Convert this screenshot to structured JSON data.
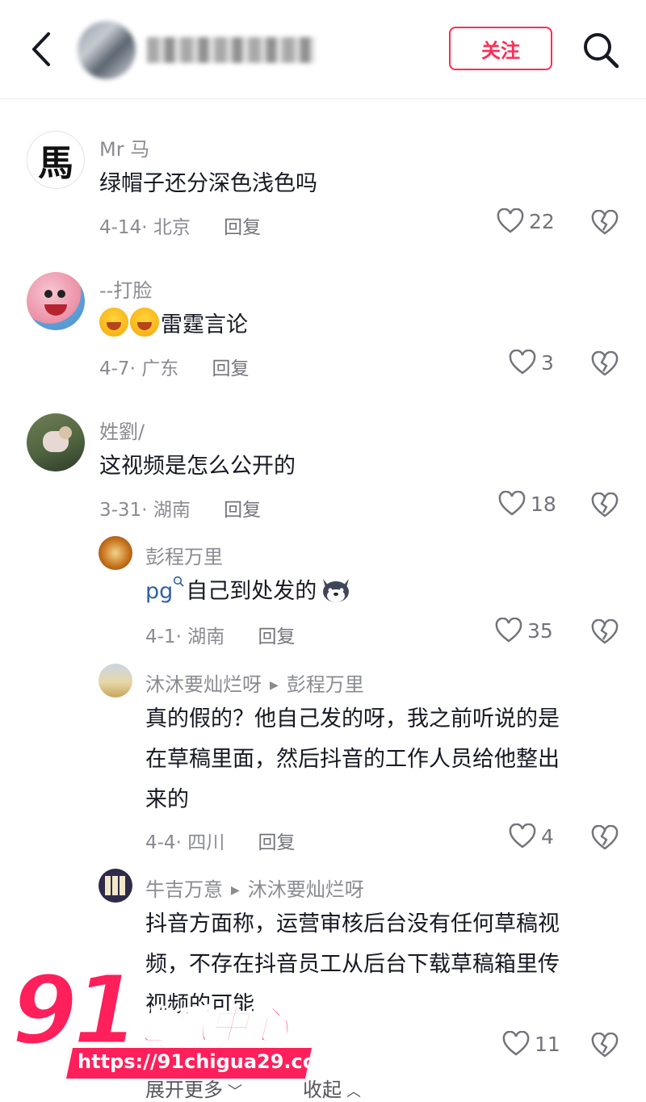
{
  "header": {
    "follow_label": "关注"
  },
  "comments": [
    {
      "user": "Mr 马",
      "text": "绿帽子还分深色浅色吗",
      "date": "4-14",
      "location": "北京",
      "reply": "回复",
      "likes": "22",
      "avatar_glyph": "馬"
    },
    {
      "user": "--打脸",
      "text": "雷霆言论",
      "date": "4-7",
      "location": "广东",
      "reply": "回复",
      "likes": "3"
    },
    {
      "user": "姓劉/",
      "text": "这视频是怎么公开的",
      "date": "3-31",
      "location": "湖南",
      "reply": "回复",
      "likes": "18"
    }
  ],
  "replies": [
    {
      "user": "彭程万里",
      "prefix": "pg",
      "text": "自己到处发的",
      "date": "4-1",
      "location": "湖南",
      "reply": "回复",
      "likes": "35"
    },
    {
      "user": "沐沐要灿烂呀",
      "reply_to": "彭程万里",
      "text_lines": [
        "真的假的？他自己发的呀，我之前听说的是",
        "在草稿里面，然后抖音的工作人员给他整出",
        "来的"
      ],
      "date": "4-4",
      "location": "四川",
      "reply": "回复",
      "likes": "4"
    },
    {
      "user": "牛吉万意",
      "reply_to": "沐沐要灿烂呀",
      "text_lines": [
        "抖音方面称，运营审核后台没有任何草稿视",
        "频，不存在抖音员工从后台下载草稿箱里传",
        "视频的可能"
      ],
      "likes": "11"
    }
  ],
  "footer": {
    "expand": "展开更多",
    "collapse": "收起"
  },
  "watermark": {
    "number": "91",
    "brand": "吃瓜中心",
    "url": "https://91chigua29.com"
  },
  "colors": {
    "accent": "#fe2c55",
    "meta": "#8a8b91",
    "text": "#161823"
  }
}
